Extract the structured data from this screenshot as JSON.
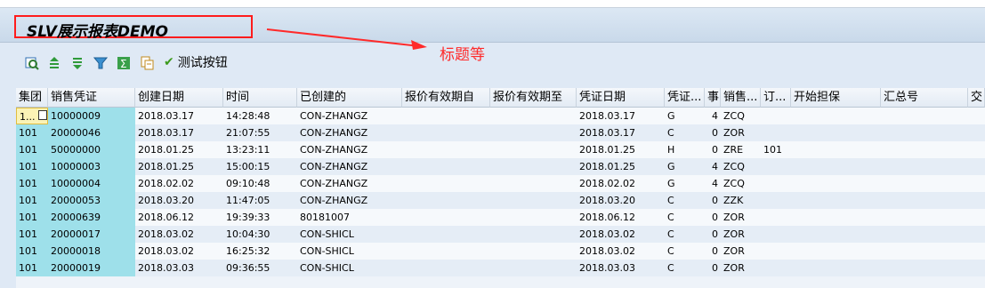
{
  "title": "SLV展示报表DEMO",
  "annotation": "标题等",
  "toolbar": {
    "buttons": [
      "details-icon",
      "sort-asc-icon",
      "sort-desc-icon",
      "filter-icon",
      "sum-icon",
      "subtotal-icon"
    ],
    "execute_label": "测试按钮"
  },
  "columns": [
    "集团",
    "销售凭证",
    "创建日期",
    "时间",
    "已创建的",
    "报价有效期自",
    "报价有效期至",
    "凭证日期",
    "凭证...",
    "事",
    "销售...",
    "订...",
    "开始担保",
    "汇总号",
    "交"
  ],
  "rows": [
    [
      "1...",
      "10000009",
      "2018.03.17",
      "14:28:48",
      "CON-ZHANGZ",
      "",
      "",
      "2018.03.17",
      "G",
      "4",
      "ZCQ",
      "",
      "",
      "",
      ""
    ],
    [
      "101",
      "20000046",
      "2018.03.17",
      "21:07:55",
      "CON-ZHANGZ",
      "",
      "",
      "2018.03.17",
      "C",
      "0",
      "ZOR",
      "",
      "",
      "",
      ""
    ],
    [
      "101",
      "50000000",
      "2018.01.25",
      "13:23:11",
      "CON-ZHANGZ",
      "",
      "",
      "2018.01.25",
      "H",
      "0",
      "ZRE",
      "101",
      "",
      "",
      ""
    ],
    [
      "101",
      "10000003",
      "2018.01.25",
      "15:00:15",
      "CON-ZHANGZ",
      "",
      "",
      "2018.01.25",
      "G",
      "4",
      "ZCQ",
      "",
      "",
      "",
      ""
    ],
    [
      "101",
      "10000004",
      "2018.02.02",
      "09:10:48",
      "CON-ZHANGZ",
      "",
      "",
      "2018.02.02",
      "G",
      "4",
      "ZCQ",
      "",
      "",
      "",
      ""
    ],
    [
      "101",
      "20000053",
      "2018.03.20",
      "11:47:05",
      "CON-ZHANGZ",
      "",
      "",
      "2018.03.20",
      "C",
      "0",
      "ZZK",
      "",
      "",
      "",
      ""
    ],
    [
      "101",
      "20000639",
      "2018.06.12",
      "19:39:33",
      "80181007",
      "",
      "",
      "2018.06.12",
      "C",
      "0",
      "ZOR",
      "",
      "",
      "",
      ""
    ],
    [
      "101",
      "20000017",
      "2018.03.02",
      "10:04:30",
      "CON-SHICL",
      "",
      "",
      "2018.03.02",
      "C",
      "0",
      "ZOR",
      "",
      "",
      "",
      ""
    ],
    [
      "101",
      "20000018",
      "2018.03.02",
      "16:25:32",
      "CON-SHICL",
      "",
      "",
      "2018.03.02",
      "C",
      "0",
      "ZOR",
      "",
      "",
      "",
      ""
    ],
    [
      "101",
      "20000019",
      "2018.03.03",
      "09:36:55",
      "CON-SHICL",
      "",
      "",
      "2018.03.03",
      "C",
      "0",
      "ZOR",
      "",
      "",
      "",
      ""
    ]
  ]
}
